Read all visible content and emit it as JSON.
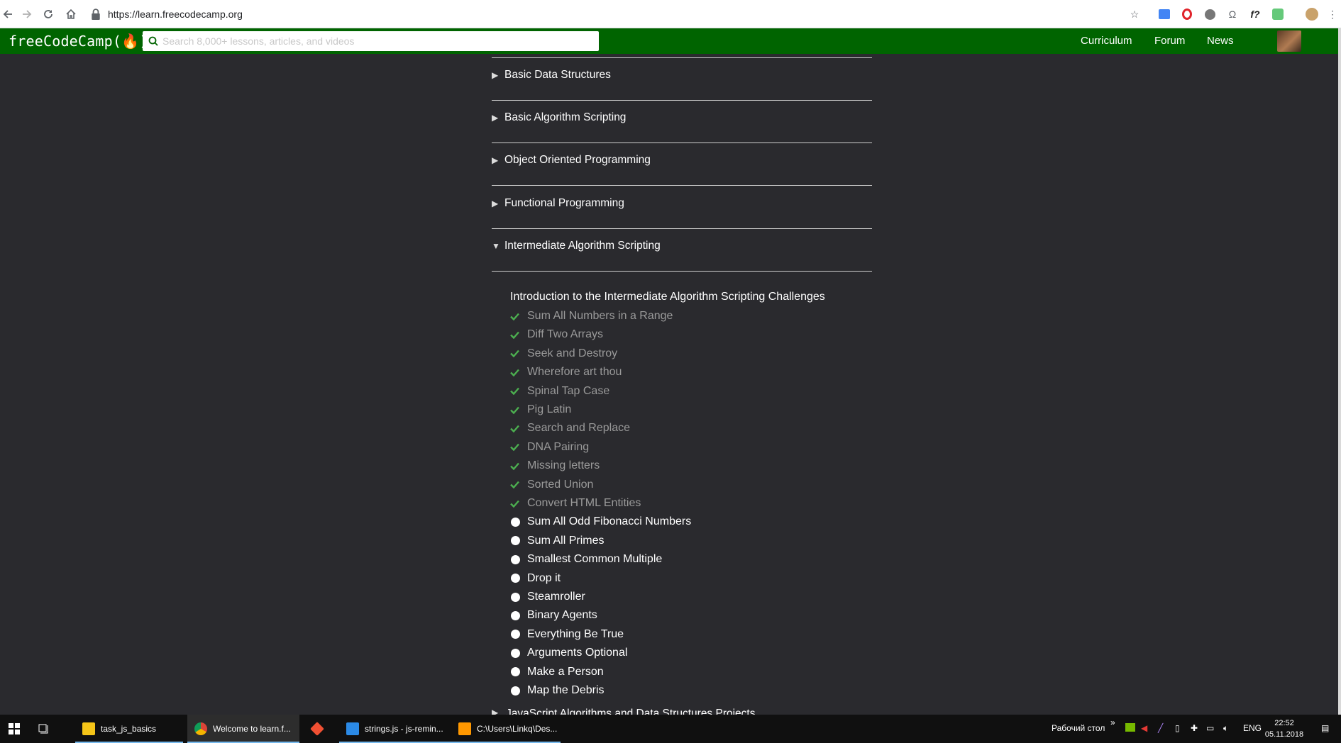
{
  "browser": {
    "url": "https://learn.freecodecamp.org"
  },
  "fcc_nav": {
    "logo": "freeCodeCamp(🔥)",
    "search_placeholder": "Search 8,000+ lessons, articles, and videos",
    "links": [
      "Curriculum",
      "Forum",
      "News"
    ]
  },
  "blocks": [
    {
      "title": "Basic Data Structures",
      "expanded": false
    },
    {
      "title": "Basic Algorithm Scripting",
      "expanded": false
    },
    {
      "title": "Object Oriented Programming",
      "expanded": false
    },
    {
      "title": "Functional Programming",
      "expanded": false
    },
    {
      "title": "Intermediate Algorithm Scripting",
      "expanded": true
    }
  ],
  "intro": "Introduction to the Intermediate Algorithm Scripting Challenges",
  "challenges": [
    {
      "title": "Sum All Numbers in a Range",
      "completed": true
    },
    {
      "title": "Diff Two Arrays",
      "completed": true
    },
    {
      "title": "Seek and Destroy",
      "completed": true
    },
    {
      "title": "Wherefore art thou",
      "completed": true
    },
    {
      "title": "Spinal Tap Case",
      "completed": true
    },
    {
      "title": "Pig Latin",
      "completed": true
    },
    {
      "title": "Search and Replace",
      "completed": true
    },
    {
      "title": "DNA Pairing",
      "completed": true
    },
    {
      "title": "Missing letters",
      "completed": true
    },
    {
      "title": "Sorted Union",
      "completed": true
    },
    {
      "title": "Convert HTML Entities",
      "completed": true
    },
    {
      "title": "Sum All Odd Fibonacci Numbers",
      "completed": false
    },
    {
      "title": "Sum All Primes",
      "completed": false
    },
    {
      "title": "Smallest Common Multiple",
      "completed": false
    },
    {
      "title": "Drop it",
      "completed": false
    },
    {
      "title": "Steamroller",
      "completed": false
    },
    {
      "title": "Binary Agents",
      "completed": false
    },
    {
      "title": "Everything Be True",
      "completed": false
    },
    {
      "title": "Arguments Optional",
      "completed": false
    },
    {
      "title": "Make a Person",
      "completed": false
    },
    {
      "title": "Map the Debris",
      "completed": false
    }
  ],
  "next_block_partial": "JavaScript Algorithms and Data Structures Projects",
  "colors": {
    "nav_green": "#006400",
    "page_bg": "#2a2a2e",
    "check_green": "#4caf50"
  },
  "taskbar": {
    "items": [
      {
        "label": "task_js_basics",
        "icon": "folder-icon"
      },
      {
        "label": "Welcome to learn.f...",
        "icon": "chrome-icon",
        "active": true
      },
      {
        "label": "",
        "icon": "git-icon"
      },
      {
        "label": "strings.js - js-remin...",
        "icon": "vscode-icon"
      },
      {
        "label": "C:\\Users\\Linkq\\Des...",
        "icon": "sublime-icon"
      }
    ],
    "desktop_label": "Рабочий стол",
    "lang": "ENG",
    "time": "22:52",
    "date": "05.11.2018"
  }
}
